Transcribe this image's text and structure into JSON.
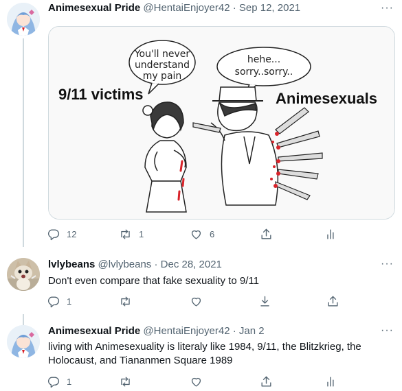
{
  "tweets": [
    {
      "name": "Animesexual Pride",
      "handle": "@HentaiEnjoyer42",
      "date": "Sep 12, 2021",
      "avatar_icon": "anime-girl-avatar",
      "image": {
        "left_label": "9/11 victims",
        "right_label": "Animesexuals",
        "left_bubble": [
          "You'll never",
          "understand",
          "my pain"
        ],
        "right_bubble": [
          "hehe...",
          "sorry..sorry.."
        ]
      },
      "stats": {
        "replies": "12",
        "retweets": "1",
        "likes": "6"
      }
    },
    {
      "name": "lvlybeans",
      "handle": "@lvlybeans",
      "date": "Dec 28, 2021",
      "avatar_icon": "kitten-avatar",
      "text": "Don't even compare that fake sexuality to 9/11",
      "stats": {
        "replies": "1",
        "retweets": "",
        "likes": ""
      }
    },
    {
      "name": "Animesexual Pride",
      "handle": "@HentaiEnjoyer42",
      "date": "Jan 2",
      "avatar_icon": "anime-girl-avatar",
      "text": "living with Animesexuality is literaly like 1984, 9/11, the Blitzkrieg, the Holocaust, and Tiananmen Square 1989",
      "stats": {
        "replies": "1",
        "retweets": "",
        "likes": ""
      }
    }
  ],
  "ui": {
    "dot": "·",
    "more": "···"
  },
  "colors": {
    "text": "#0f1419",
    "secondary": "#536471",
    "line": "#cfd9de",
    "blood": "#d8232a"
  }
}
